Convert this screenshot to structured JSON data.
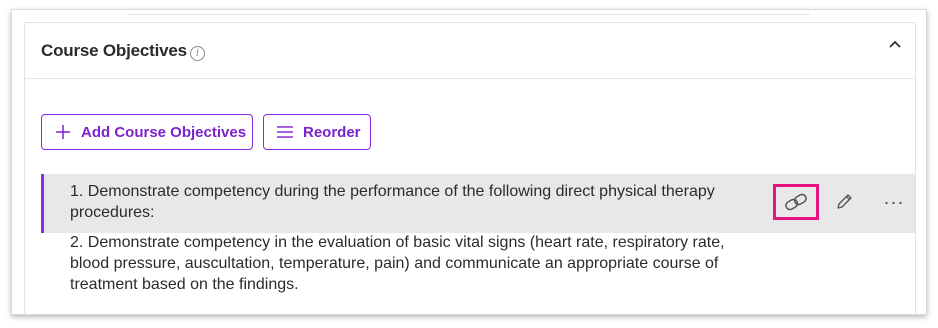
{
  "section": {
    "title": "Course Objectives",
    "info_icon": "info-icon",
    "collapse_icon": "chevron-up-icon"
  },
  "toolbar": {
    "add_label": "Add Course Objectives",
    "add_icon": "plus-icon",
    "reorder_label": "Reorder",
    "reorder_icon": "menu-lines-icon"
  },
  "objectives": [
    {
      "text": "1. Demonstrate competency during the performance of the following direct physical therapy procedures:",
      "selected": true,
      "actions": {
        "link_icon": "link-icon",
        "edit_icon": "pencil-icon",
        "more_label": "···"
      }
    },
    {
      "text": "2. Demonstrate competency in the evaluation of basic vital signs (heart rate, respiratory rate, blood pressure, auscultation, temperature, pain) and communicate an appropriate course of treatment based on the findings.",
      "selected": false
    }
  ],
  "colors": {
    "accent": "#8c2be2",
    "highlight_box": "#e8137f",
    "selected_row_bg": "#e8e8e8"
  }
}
